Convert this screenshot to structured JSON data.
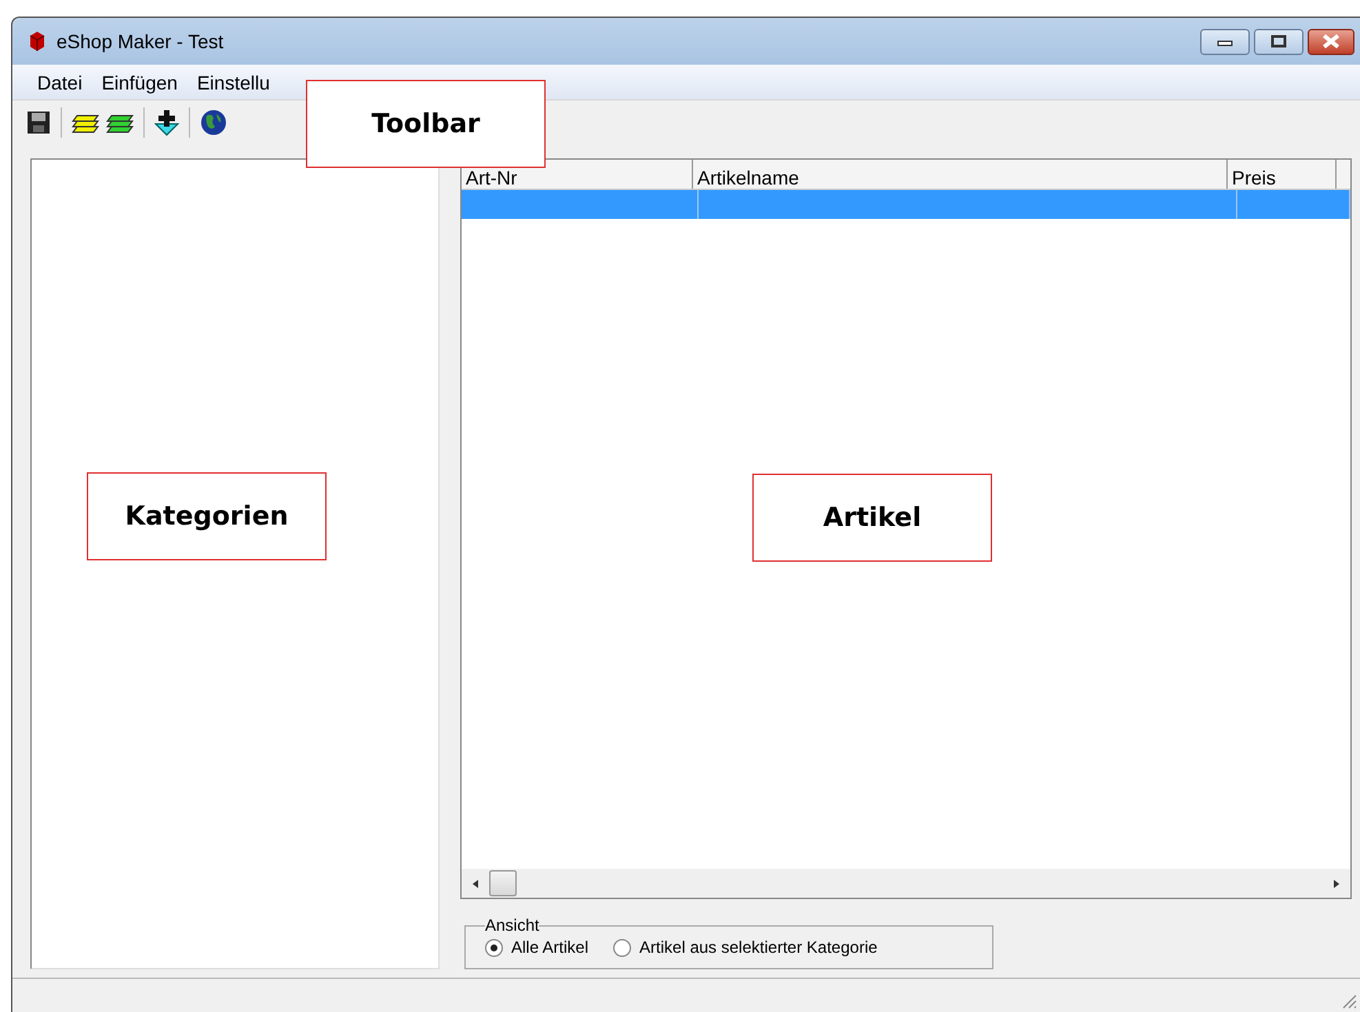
{
  "window": {
    "title": "eShop Maker - Test"
  },
  "menu": [
    {
      "label": "Datei"
    },
    {
      "label": "Einfügen"
    },
    {
      "label": "Einstellu"
    }
  ],
  "toolbar": [
    {
      "kind": "save"
    },
    {
      "kind": "separator"
    },
    {
      "kind": "layers",
      "color": "#f0f000"
    },
    {
      "kind": "layers",
      "color": "#30d030"
    },
    {
      "kind": "separator"
    },
    {
      "kind": "add-down"
    },
    {
      "kind": "separator"
    },
    {
      "kind": "globe"
    }
  ],
  "table": {
    "columns": [
      "Art-Nr",
      "Artikelname",
      "Preis"
    ],
    "rows": [
      {
        "selected": true
      }
    ]
  },
  "view_group": {
    "title": "Ansicht",
    "options": [
      {
        "label": "Alle Artikel",
        "selected": true
      },
      {
        "label": "Artikel aus selektierter Kategorie",
        "selected": false
      }
    ]
  },
  "annotations": [
    {
      "label": "Toolbar"
    },
    {
      "label": "Kategorien"
    },
    {
      "label": "Artikel"
    }
  ]
}
